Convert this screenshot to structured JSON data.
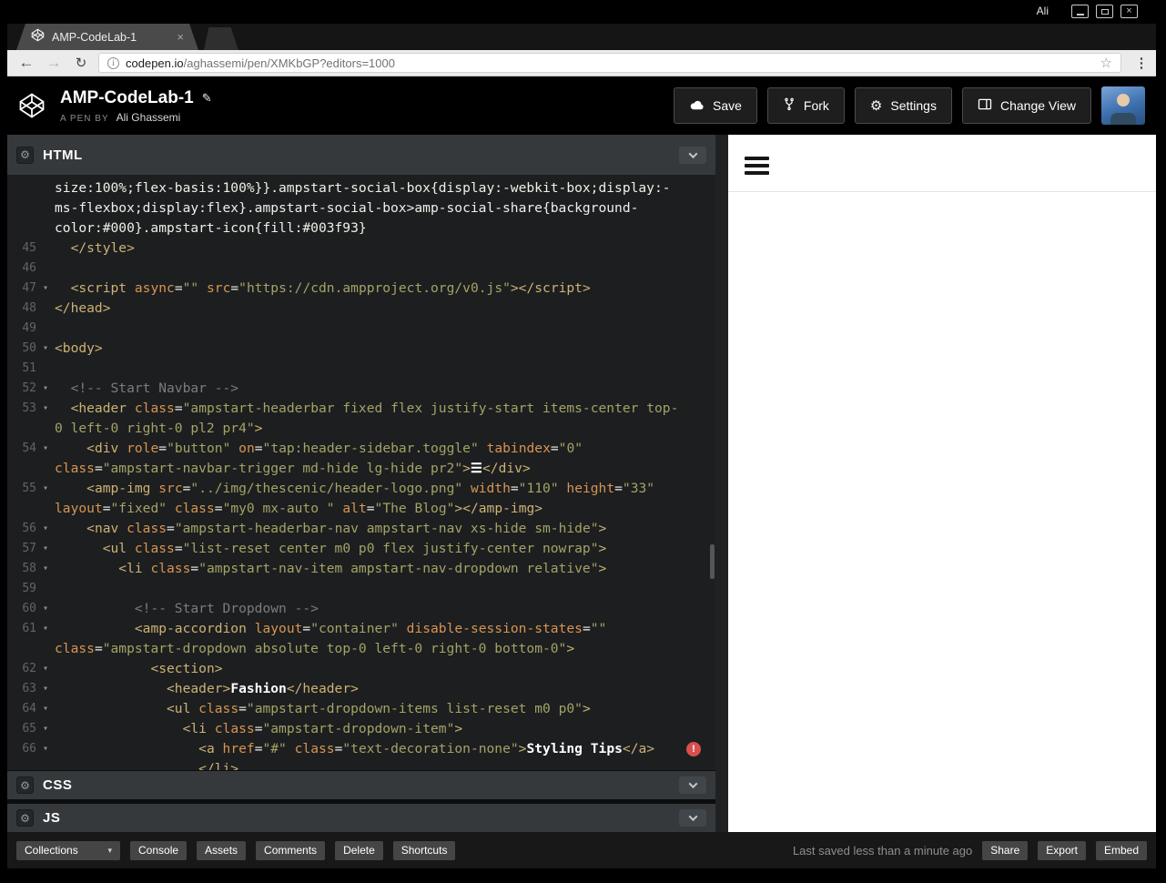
{
  "window": {
    "user": "Ali"
  },
  "browser": {
    "tab_title": "AMP-CodeLab-1",
    "url_host": "codepen.io",
    "url_rest": "/aghassemi/pen/XMKbGP?editors=1000"
  },
  "icons": {
    "back": "←",
    "forward": "→",
    "reload": "↻",
    "star": "☆",
    "overflow": "⋮",
    "info": "i",
    "close": "×",
    "gear": "⚙",
    "pencil": "✎",
    "caret_down": "▾"
  },
  "header": {
    "title": "AMP-CodeLab-1",
    "byline_prefix": "A PEN BY",
    "author": "Ali Ghassemi",
    "buttons": {
      "save": "Save",
      "fork": "Fork",
      "settings": "Settings",
      "change_view": "Change View"
    }
  },
  "panels": {
    "html_label": "HTML",
    "css_label": "CSS",
    "js_label": "JS"
  },
  "colors": {
    "tag": "#ccb374",
    "attr": "#d79552",
    "string": "#a2a465",
    "comment": "#7c7c7c",
    "plain": "#efefe9",
    "error": "#d94f4f",
    "editor_bg": "#1d1e20",
    "active_tab": "#4a4a4a"
  },
  "editor": {
    "fold_glyph": "▾",
    "error_glyph": "!",
    "lines": [
      {
        "n": "",
        "seg": [
          [
            "p",
            "size:100%;flex-basis:100%}}.ampstart-social-box{display:-webkit-box;display:-"
          ]
        ]
      },
      {
        "n": "",
        "seg": [
          [
            "p",
            "ms-flexbox;display:flex}.ampstart-social-box>amp-social-share{background-"
          ]
        ]
      },
      {
        "n": "",
        "seg": [
          [
            "p",
            "color:#000}.ampstart-icon{fill:#003f93}"
          ]
        ]
      },
      {
        "n": "45",
        "seg": [
          [
            "p",
            "  "
          ],
          [
            "t",
            "</style>"
          ]
        ]
      },
      {
        "n": "46",
        "seg": []
      },
      {
        "n": "47",
        "f": 1,
        "seg": [
          [
            "p",
            "  "
          ],
          [
            "t",
            "<script"
          ],
          [
            "p",
            " "
          ],
          [
            "a",
            "async"
          ],
          [
            "p",
            "="
          ],
          [
            "s",
            "\"\""
          ],
          [
            "p",
            " "
          ],
          [
            "a",
            "src"
          ],
          [
            "p",
            "="
          ],
          [
            "s",
            "\"https://cdn.ampproject.org/v0.js\""
          ],
          [
            "t",
            "></script>"
          ]
        ]
      },
      {
        "n": "48",
        "seg": [
          [
            "t",
            "</head>"
          ]
        ]
      },
      {
        "n": "49",
        "seg": []
      },
      {
        "n": "50",
        "f": 1,
        "seg": [
          [
            "t",
            "<body>"
          ]
        ]
      },
      {
        "n": "51",
        "seg": []
      },
      {
        "n": "52",
        "f": 1,
        "seg": [
          [
            "p",
            "  "
          ],
          [
            "c",
            "<!-- Start Navbar -->"
          ]
        ]
      },
      {
        "n": "53",
        "f": 1,
        "seg": [
          [
            "p",
            "  "
          ],
          [
            "t",
            "<header"
          ],
          [
            "p",
            " "
          ],
          [
            "a",
            "class"
          ],
          [
            "p",
            "="
          ],
          [
            "s",
            "\"ampstart-headerbar fixed flex justify-start items-center top-"
          ]
        ]
      },
      {
        "n": "",
        "seg": [
          [
            "s",
            "0 left-0 right-0 pl2 pr4\""
          ],
          [
            "t",
            ">"
          ]
        ]
      },
      {
        "n": "54",
        "f": 1,
        "seg": [
          [
            "p",
            "    "
          ],
          [
            "t",
            "<div"
          ],
          [
            "p",
            " "
          ],
          [
            "a",
            "role"
          ],
          [
            "p",
            "="
          ],
          [
            "s",
            "\"button\""
          ],
          [
            "p",
            " "
          ],
          [
            "a",
            "on"
          ],
          [
            "p",
            "="
          ],
          [
            "s",
            "\"tap:header-sidebar.toggle\""
          ],
          [
            "p",
            " "
          ],
          [
            "a",
            "tabindex"
          ],
          [
            "p",
            "="
          ],
          [
            "s",
            "\"0\""
          ]
        ]
      },
      {
        "n": "",
        "seg": [
          [
            "a",
            "class"
          ],
          [
            "p",
            "="
          ],
          [
            "s",
            "\"ampstart-navbar-trigger md-hide lg-hide pr2\""
          ],
          [
            "t",
            ">"
          ],
          [
            "x",
            "☰"
          ],
          [
            "t",
            "</div>"
          ]
        ]
      },
      {
        "n": "55",
        "f": 1,
        "seg": [
          [
            "p",
            "    "
          ],
          [
            "t",
            "<amp-img"
          ],
          [
            "p",
            " "
          ],
          [
            "a",
            "src"
          ],
          [
            "p",
            "="
          ],
          [
            "s",
            "\"../img/thescenic/header-logo.png\""
          ],
          [
            "p",
            " "
          ],
          [
            "a",
            "width"
          ],
          [
            "p",
            "="
          ],
          [
            "s",
            "\"110\""
          ],
          [
            "p",
            " "
          ],
          [
            "a",
            "height"
          ],
          [
            "p",
            "="
          ],
          [
            "s",
            "\"33\""
          ]
        ]
      },
      {
        "n": "",
        "seg": [
          [
            "a",
            "layout"
          ],
          [
            "p",
            "="
          ],
          [
            "s",
            "\"fixed\""
          ],
          [
            "p",
            " "
          ],
          [
            "a",
            "class"
          ],
          [
            "p",
            "="
          ],
          [
            "s",
            "\"my0 mx-auto \""
          ],
          [
            "p",
            " "
          ],
          [
            "a",
            "alt"
          ],
          [
            "p",
            "="
          ],
          [
            "s",
            "\"The Blog\""
          ],
          [
            "t",
            "></amp-img>"
          ]
        ]
      },
      {
        "n": "56",
        "f": 1,
        "seg": [
          [
            "p",
            "    "
          ],
          [
            "t",
            "<nav"
          ],
          [
            "p",
            " "
          ],
          [
            "a",
            "class"
          ],
          [
            "p",
            "="
          ],
          [
            "s",
            "\"ampstart-headerbar-nav ampstart-nav xs-hide sm-hide\""
          ],
          [
            "t",
            ">"
          ]
        ]
      },
      {
        "n": "57",
        "f": 1,
        "seg": [
          [
            "p",
            "      "
          ],
          [
            "t",
            "<ul"
          ],
          [
            "p",
            " "
          ],
          [
            "a",
            "class"
          ],
          [
            "p",
            "="
          ],
          [
            "s",
            "\"list-reset center m0 p0 flex justify-center nowrap\""
          ],
          [
            "t",
            ">"
          ]
        ]
      },
      {
        "n": "58",
        "f": 1,
        "seg": [
          [
            "p",
            "        "
          ],
          [
            "t",
            "<li"
          ],
          [
            "p",
            " "
          ],
          [
            "a",
            "class"
          ],
          [
            "p",
            "="
          ],
          [
            "s",
            "\"ampstart-nav-item ampstart-nav-dropdown relative\""
          ],
          [
            "t",
            ">"
          ]
        ]
      },
      {
        "n": "59",
        "seg": []
      },
      {
        "n": "60",
        "f": 1,
        "seg": [
          [
            "p",
            "          "
          ],
          [
            "c",
            "<!-- Start Dropdown -->"
          ]
        ]
      },
      {
        "n": "61",
        "f": 1,
        "seg": [
          [
            "p",
            "          "
          ],
          [
            "t",
            "<amp-accordion"
          ],
          [
            "p",
            " "
          ],
          [
            "a",
            "layout"
          ],
          [
            "p",
            "="
          ],
          [
            "s",
            "\"container\""
          ],
          [
            "p",
            " "
          ],
          [
            "a",
            "disable-session-states"
          ],
          [
            "p",
            "="
          ],
          [
            "s",
            "\"\""
          ]
        ]
      },
      {
        "n": "",
        "seg": [
          [
            "a",
            "class"
          ],
          [
            "p",
            "="
          ],
          [
            "s",
            "\"ampstart-dropdown absolute top-0 left-0 right-0 bottom-0\""
          ],
          [
            "t",
            ">"
          ]
        ]
      },
      {
        "n": "62",
        "f": 1,
        "seg": [
          [
            "p",
            "            "
          ],
          [
            "t",
            "<section>"
          ]
        ]
      },
      {
        "n": "63",
        "f": 1,
        "seg": [
          [
            "p",
            "              "
          ],
          [
            "t",
            "<header>"
          ],
          [
            "x",
            "Fashion"
          ],
          [
            "t",
            "</header>"
          ]
        ]
      },
      {
        "n": "64",
        "f": 1,
        "seg": [
          [
            "p",
            "              "
          ],
          [
            "t",
            "<ul"
          ],
          [
            "p",
            " "
          ],
          [
            "a",
            "class"
          ],
          [
            "p",
            "="
          ],
          [
            "s",
            "\"ampstart-dropdown-items list-reset m0 p0\""
          ],
          [
            "t",
            ">"
          ]
        ]
      },
      {
        "n": "65",
        "f": 1,
        "seg": [
          [
            "p",
            "                "
          ],
          [
            "t",
            "<li"
          ],
          [
            "p",
            " "
          ],
          [
            "a",
            "class"
          ],
          [
            "p",
            "="
          ],
          [
            "s",
            "\"ampstart-dropdown-item\""
          ],
          [
            "t",
            ">"
          ]
        ]
      },
      {
        "n": "66",
        "f": 1,
        "e": 1,
        "seg": [
          [
            "p",
            "                  "
          ],
          [
            "t",
            "<a"
          ],
          [
            "p",
            " "
          ],
          [
            "a",
            "href"
          ],
          [
            "p",
            "="
          ],
          [
            "s",
            "\"#\""
          ],
          [
            "p",
            " "
          ],
          [
            "a",
            "class"
          ],
          [
            "p",
            "="
          ],
          [
            "s",
            "\"text-decoration-none\""
          ],
          [
            "t",
            ">"
          ],
          [
            "x",
            "Styling Tips"
          ],
          [
            "t",
            "</a>"
          ]
        ]
      },
      {
        "n": "",
        "seg": [
          [
            "p",
            "                  "
          ],
          [
            "t",
            "</li>"
          ]
        ]
      }
    ]
  },
  "footer": {
    "collections_label": "Collections",
    "buttons_left": [
      "Console",
      "Assets",
      "Comments",
      "Delete",
      "Shortcuts"
    ],
    "status": "Last saved less than a minute ago",
    "buttons_right": [
      "Share",
      "Export",
      "Embed"
    ]
  }
}
